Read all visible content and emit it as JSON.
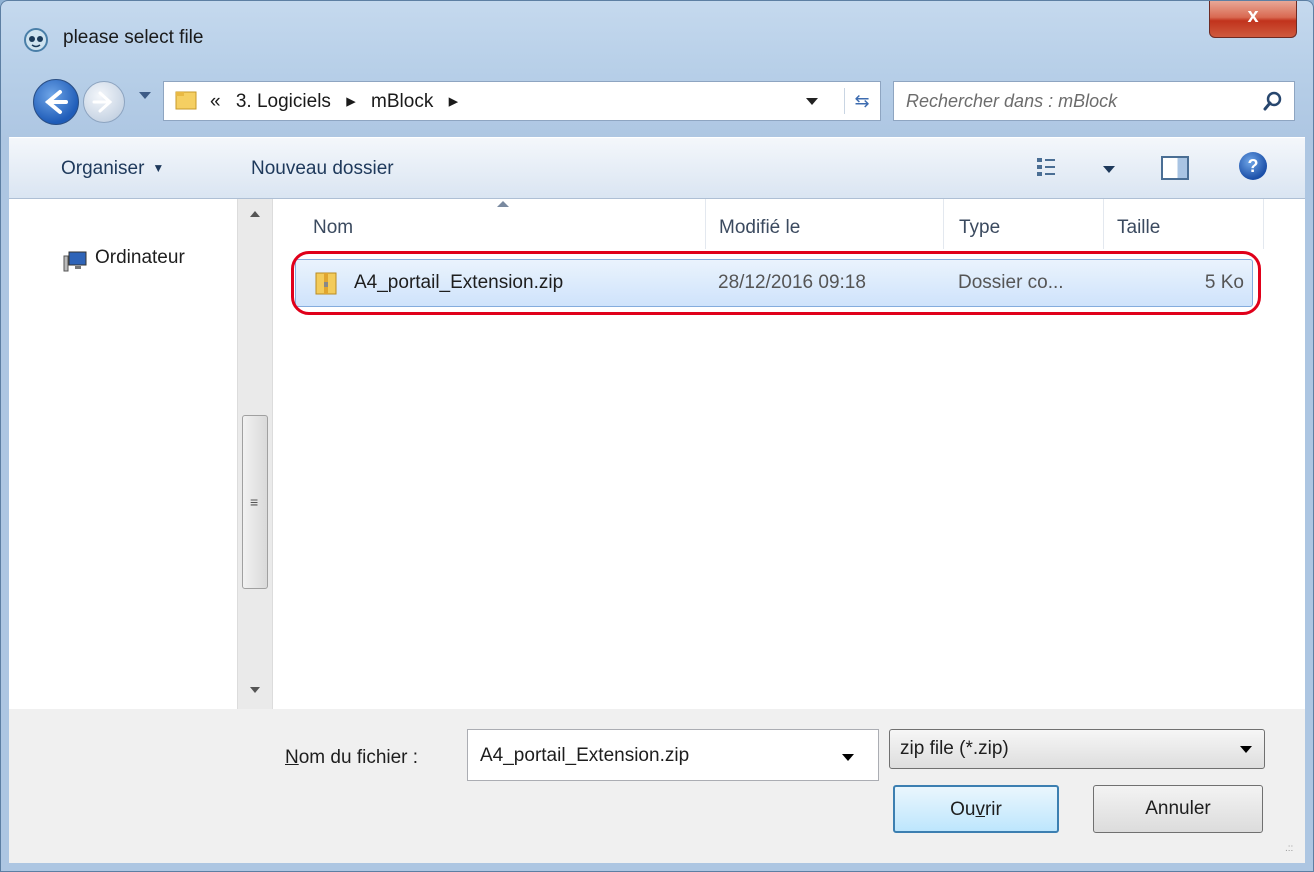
{
  "window": {
    "title": "please select file",
    "close_label": "x"
  },
  "nav": {
    "breadcrumb": [
      "«",
      "3. Logiciels",
      "▸",
      "mBlock",
      "▸"
    ],
    "search_placeholder": "Rechercher dans : mBlock"
  },
  "toolbar": {
    "organize_label": "Organiser",
    "new_folder_label": "Nouveau dossier",
    "help_label": "?"
  },
  "sidebar": {
    "items": [
      {
        "label": "Ordinateur",
        "icon": "computer-icon"
      }
    ]
  },
  "file_list": {
    "columns": [
      "Nom",
      "Modifié le",
      "Type",
      "Taille"
    ],
    "rows": [
      {
        "name": "A4_portail_Extension.zip",
        "modified": "28/12/2016 09:18",
        "type": "Dossier co...",
        "size": "5 Ko",
        "icon": "zip-folder-icon",
        "selected": true
      }
    ]
  },
  "footer": {
    "filename_label_prefix": "N",
    "filename_label_rest": "om du fichier :",
    "filename_value": "A4_portail_Extension.zip",
    "filetype_value": "zip file (*.zip)",
    "open_label_pre": "Ou",
    "open_label_u": "v",
    "open_label_post": "rir",
    "cancel_label": "Annuler"
  },
  "colors": {
    "highlight_ring": "#e0001a",
    "selection_fill": "#cfe3fb",
    "chrome": "#b7cfe8"
  }
}
